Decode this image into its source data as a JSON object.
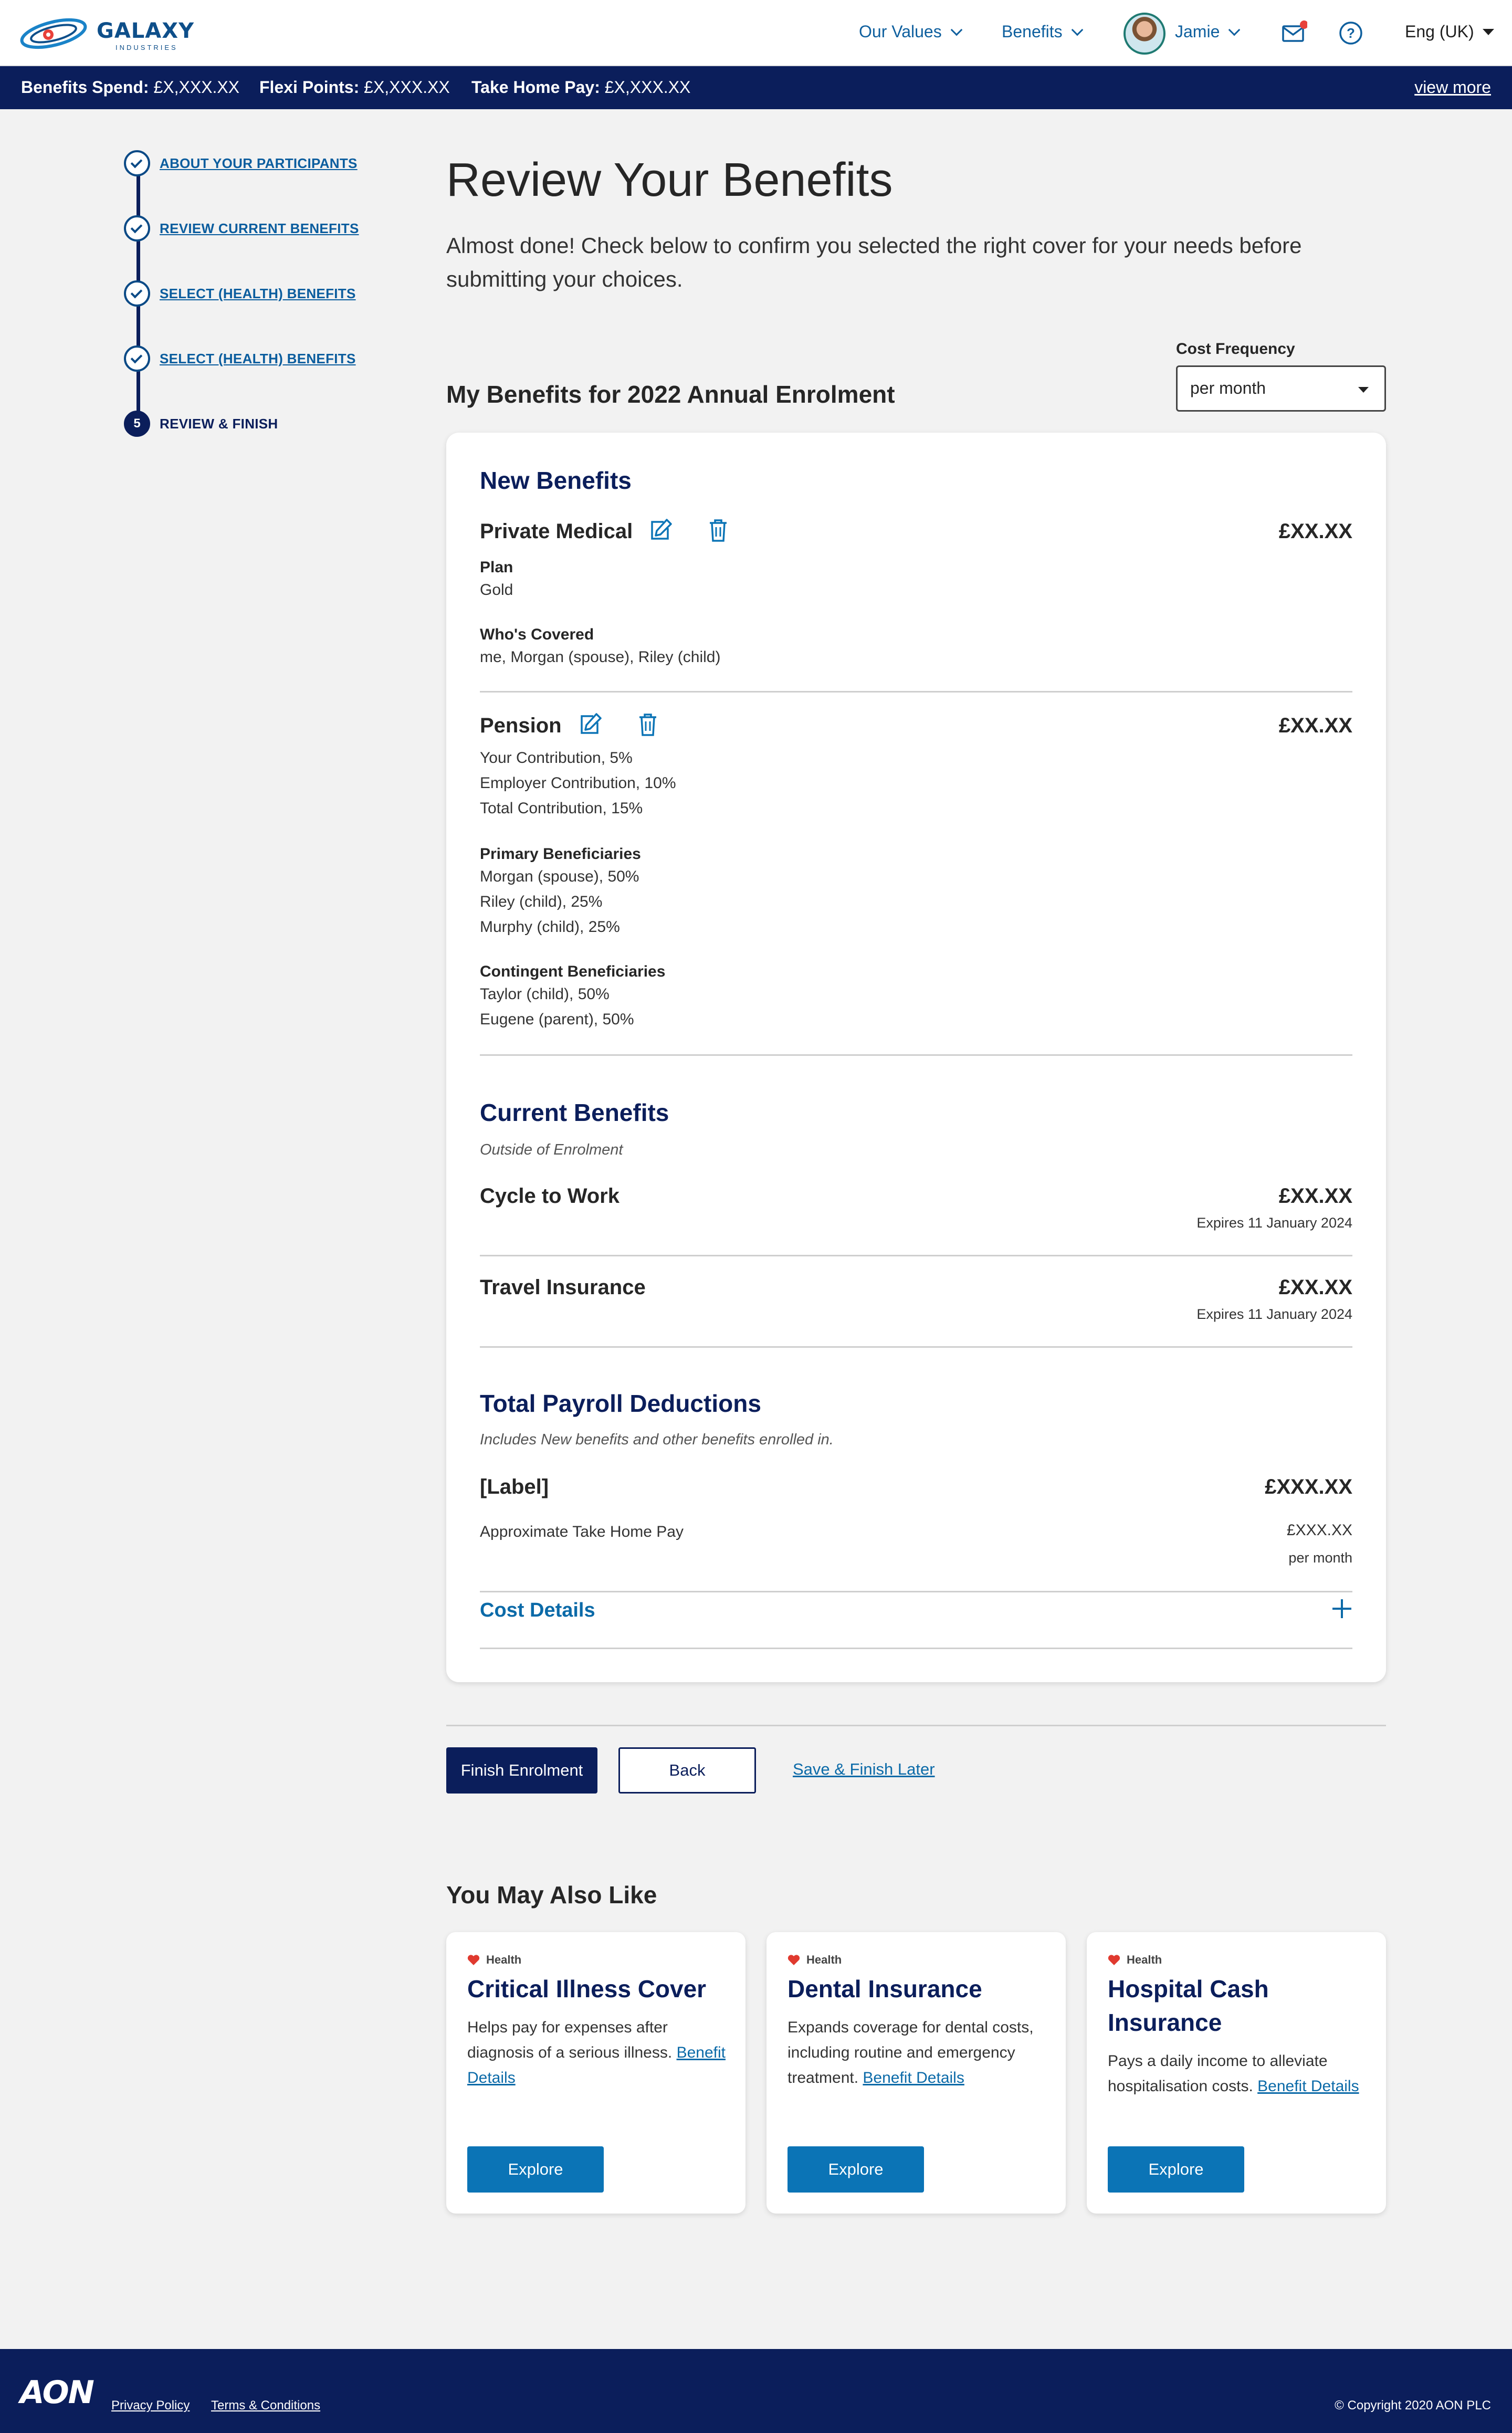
{
  "brand": {
    "name": "GALAXY",
    "sub": "INDUSTRIES"
  },
  "nav": {
    "values": "Our Values",
    "benefits": "Benefits",
    "user": "Jamie",
    "language": "Eng (UK)"
  },
  "spend": {
    "benefits_spend": "£X,XXX.XX",
    "flexi_points": "£X,XXX.XX",
    "take_home": "£X,XXX.XX",
    "benefits_spend_label": "Benefits Spend:",
    "flexi_points_label": "Flexi Points:",
    "take_home_label": "Take Home Pay:",
    "view_more": "view more"
  },
  "steps": [
    {
      "label": "ABOUT YOUR PARTICIPANTS",
      "done": true
    },
    {
      "label": "REVIEW CURRENT BENEFITS",
      "done": true
    },
    {
      "label": "SELECT (HEALTH) BENEFITS",
      "done": true
    },
    {
      "label": "SELECT (HEALTH) BENEFITS",
      "done": true
    },
    {
      "label": "REVIEW & FINISH",
      "number": "5",
      "done": false
    }
  ],
  "page": {
    "title": "Review Your Benefits",
    "intro": "Almost done! Check below to confirm you selected the right cover for your needs before submitting your choices.",
    "section_title": "My Benefits for 2022 Annual Enrolment",
    "cost_frequency_label": "Cost Frequency",
    "cost_frequency_value": "per month"
  },
  "new_benefits": {
    "heading": "New Benefits",
    "private_medical": {
      "title": "Private Medical",
      "price": "£XX.XX",
      "plan_label": "Plan",
      "plan_value": "Gold",
      "covered_label": "Who's Covered",
      "covered_value": "me, Morgan (spouse), Riley (child)"
    },
    "pension": {
      "title": "Pension",
      "price": "£XX.XX",
      "contributions": [
        "Your Contribution, 5%",
        "Employer Contribution, 10%",
        "Total Contribution, 15%"
      ],
      "primary_label": "Primary Beneficiaries",
      "primary": [
        "Morgan (spouse), 50%",
        "Riley (child), 25%",
        "Murphy (child), 25%"
      ],
      "contingent_label": "Contingent Beneficiaries",
      "contingent": [
        "Taylor (child), 50%",
        "Eugene (parent), 50%"
      ]
    }
  },
  "current_benefits": {
    "heading": "Current Benefits",
    "note": "Outside of Enrolment",
    "items": [
      {
        "title": "Cycle to Work",
        "price": "£XX.XX",
        "expires": "Expires 11 January 2024"
      },
      {
        "title": "Travel Insurance",
        "price": "£XX.XX",
        "expires": "Expires 11 January 2024"
      }
    ]
  },
  "payroll": {
    "heading": "Total Payroll Deductions",
    "note": "Includes New benefits and other benefits enrolled in.",
    "label": "[Label]",
    "label_value": "£XXX.XX",
    "take_home_label": "Approximate Take Home Pay",
    "take_home_value": "£XXX.XX",
    "take_home_period": "per month",
    "cost_details": "Cost Details"
  },
  "actions": {
    "finish": "Finish Enrolment",
    "back": "Back",
    "save_later": "Save & Finish Later"
  },
  "recommendations": {
    "heading": "You May Also Like",
    "cards": [
      {
        "tag": "Health",
        "title": "Critical Illness Cover",
        "desc": "Helps pay for expenses after diagnosis of a serious illness.",
        "link": "Benefit Details",
        "button": "Explore"
      },
      {
        "tag": "Health",
        "title": "Dental Insurance",
        "desc": "Expands coverage for dental costs, including routine and emergency treatment.",
        "link": "Benefit Details",
        "button": "Explore"
      },
      {
        "tag": "Health",
        "title": "Hospital Cash Insurance",
        "desc": "Pays a daily income to alleviate hospitalisation costs.",
        "link": "Benefit Details",
        "button": "Explore"
      }
    ]
  },
  "footer": {
    "logo": "AON",
    "privacy": "Privacy Policy",
    "terms": "Terms & Conditions",
    "copyright": "Copyright 2020 AON PLC"
  },
  "colors": {
    "navy": "#0b1e5b",
    "link_blue": "#0b6aa8",
    "button_blue": "#0b74b6",
    "heart_red": "#e03a2f",
    "notification": "#e8413a"
  }
}
